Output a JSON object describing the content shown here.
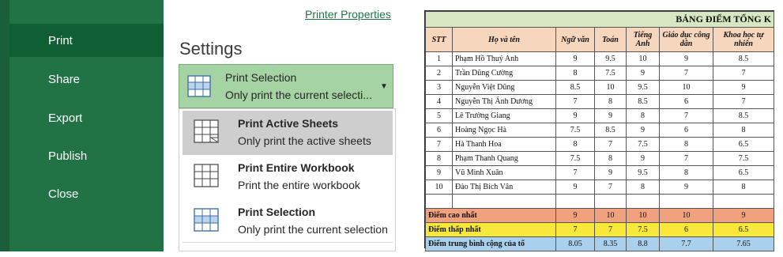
{
  "backstage": {
    "nav": {
      "items": [
        {
          "label": "Print",
          "active": true
        },
        {
          "label": "Share",
          "active": false
        },
        {
          "label": "Export",
          "active": false
        },
        {
          "label": "Publish",
          "active": false
        },
        {
          "label": "Close",
          "active": false
        }
      ]
    },
    "printer_properties": "Printer Properties",
    "settings_title": "Settings",
    "dropdown": {
      "title": "Print Selection",
      "subtitle": "Only print the current selecti...",
      "icon": "print-selection-icon"
    },
    "menu": {
      "options": [
        {
          "title": "Print Active Sheets",
          "subtitle": "Only print the active sheets",
          "icon": "active-sheets-icon",
          "selected": true
        },
        {
          "title": "Print Entire Workbook",
          "subtitle": "Print the entire workbook",
          "icon": "entire-workbook-icon",
          "selected": false
        },
        {
          "title": "Print Selection",
          "subtitle": "Only print the current selection",
          "icon": "print-selection-icon",
          "selected": false
        }
      ]
    },
    "colors": {
      "nav_bg": "#217346",
      "nav_active": "#105e33",
      "accent": "#217346",
      "dropdown_bg": "#a6d3a3"
    }
  },
  "sheet": {
    "title": "BẢNG ĐIỂM TỔNG K",
    "headers": [
      "STT",
      "Họ và tên",
      "Ngữ văn",
      "Toán",
      "Tiếng Anh",
      "Giáo dục công dân",
      "Khoa học tự nhiên"
    ],
    "rows": [
      [
        "1",
        "Phạm Hồ Thuý Anh",
        "9",
        "9.5",
        "10",
        "9",
        "8.5"
      ],
      [
        "2",
        "Trần Dũng Cường",
        "8",
        "7.5",
        "9",
        "7",
        "7"
      ],
      [
        "3",
        "Nguyễn Việt Dũng",
        "8.5",
        "10",
        "9.5",
        "10",
        "9"
      ],
      [
        "4",
        "Nguyễn Thị Ánh Dương",
        "7",
        "8",
        "8.5",
        "6",
        "7"
      ],
      [
        "5",
        "Lê Trường Giang",
        "9",
        "9",
        "8",
        "7",
        "8.5"
      ],
      [
        "6",
        "Hoàng Ngọc Hà",
        "7.5",
        "8.5",
        "9",
        "6",
        "8"
      ],
      [
        "7",
        "Hà Thanh Hoa",
        "8",
        "7",
        "7.5",
        "8",
        "6.5"
      ],
      [
        "8",
        "Phạm Thanh Quang",
        "7.5",
        "8",
        "9",
        "7",
        "7.5"
      ],
      [
        "9",
        "Vũ Minh Xuân",
        "7",
        "9",
        "9.5",
        "8",
        "6.5"
      ],
      [
        "10",
        "Đào Thị Bích Vân",
        "9",
        "7",
        "8",
        "9",
        "8"
      ]
    ],
    "summary": [
      {
        "label": "Điểm cao nhất",
        "values": [
          "9",
          "10",
          "10",
          "10",
          "9"
        ],
        "color": "#f1a17e"
      },
      {
        "label": "Điểm thấp nhất",
        "values": [
          "7",
          "7",
          "7.5",
          "6",
          "6.5"
        ],
        "color": "#f7e83a"
      },
      {
        "label": "Điểm trung bình cộng của tổ",
        "values": [
          "8.05",
          "8.35",
          "8.8",
          "7.7",
          "7.65"
        ],
        "color": "#a9d0ec"
      }
    ],
    "colors": {
      "title_bg": "#d6e7c2",
      "header_bg": "#f6d7be"
    }
  }
}
